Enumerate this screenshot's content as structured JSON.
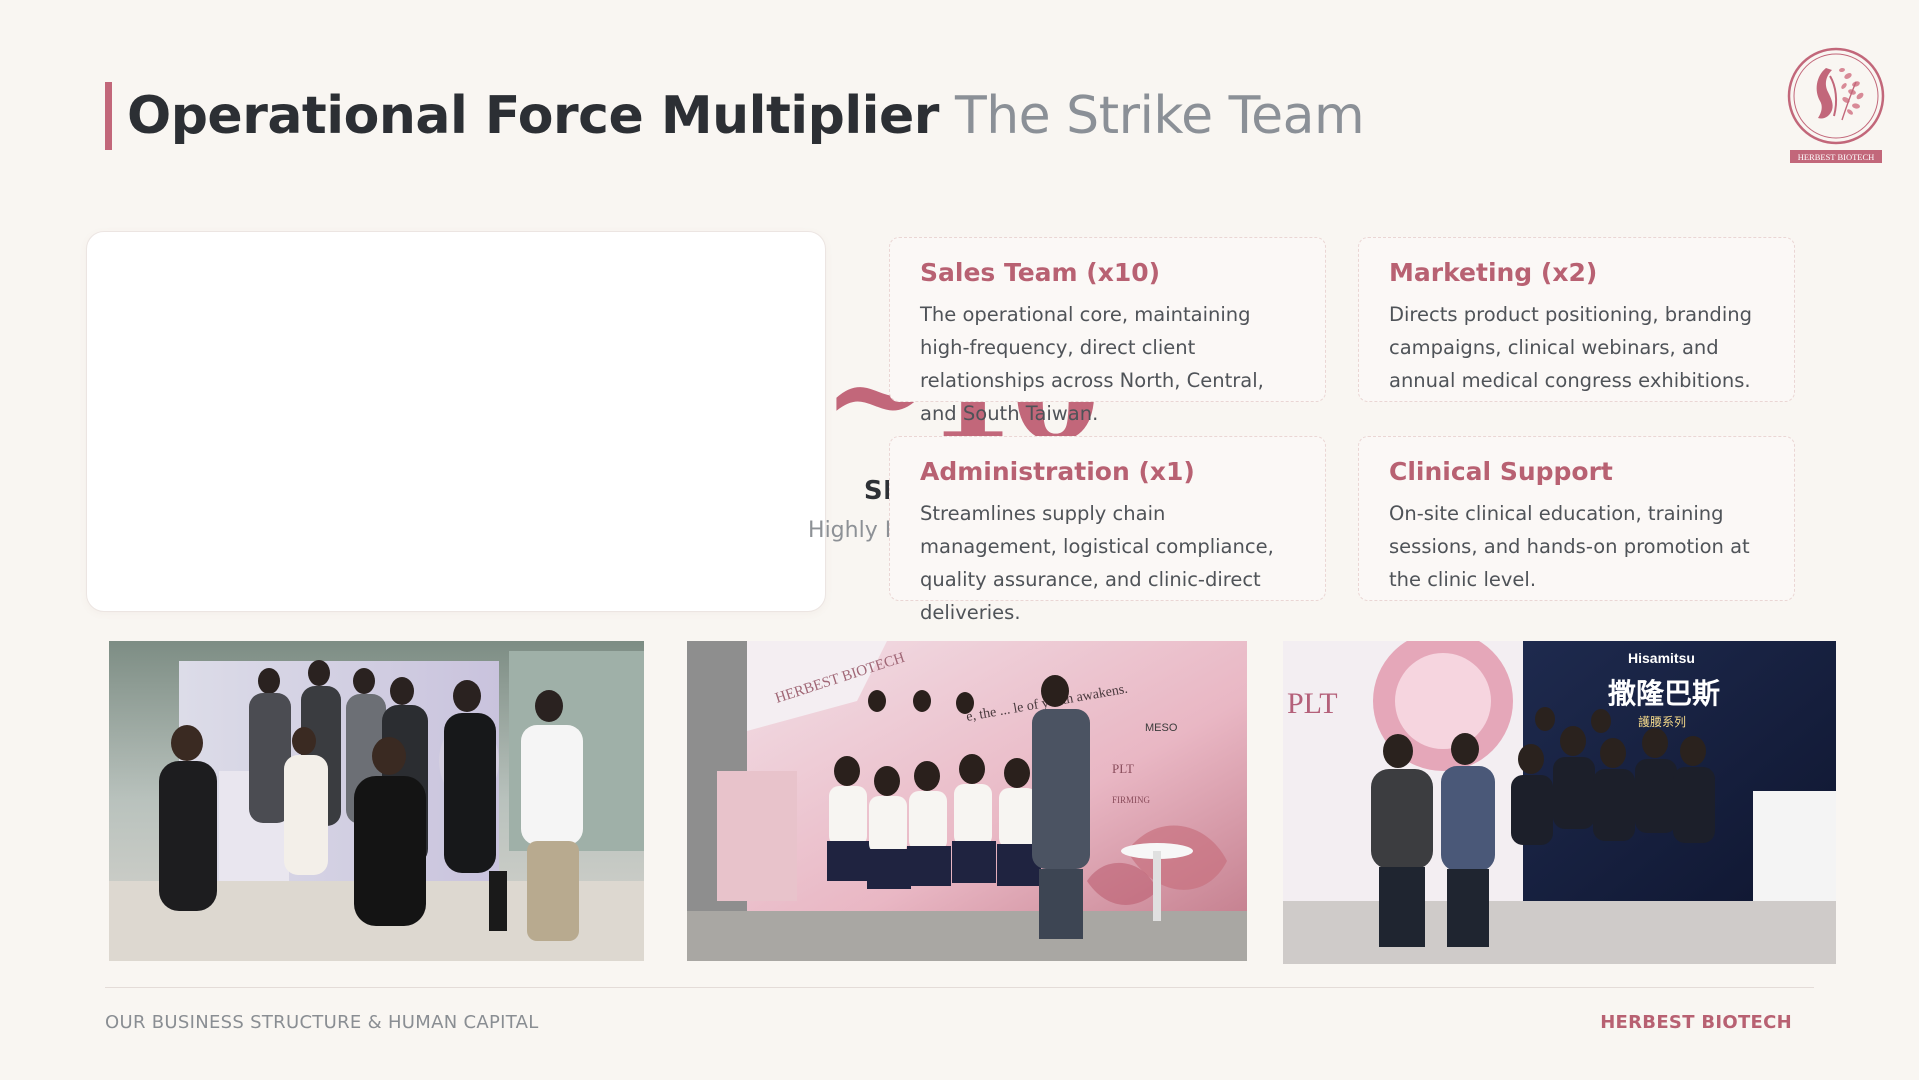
{
  "header": {
    "title_strong": "Operational Force Multiplier",
    "title_light": "The Strike Team"
  },
  "logo": {
    "text": "HERBEST BIOTECH",
    "icon": "face-leaf-logo-icon",
    "color": "#c2677a"
  },
  "stat": {
    "number": "~10",
    "label": "SPECIALISTS",
    "sublabel": "Highly Efficient Strike Force"
  },
  "teams": [
    {
      "title": "Sales Team (x10)",
      "description": "The operational core, maintaining high-frequency, direct client relationships across North, Central, and South Taiwan."
    },
    {
      "title": "Marketing (x2)",
      "description": "Directs product positioning, branding campaigns, clinical webinars, and annual medical congress exhibitions."
    },
    {
      "title": "Administration (x1)",
      "description": "Streamlines supply chain management, logistical compliance, quality assurance, and clinic-direct deliveries."
    },
    {
      "title": "Clinical Support",
      "description": "On-site clinical education, training sessions, and hands-on promotion at the clinic level."
    }
  ],
  "photos": {
    "photo2": {
      "banner_brand": "HERBEST BIOTECH",
      "banner_slogan": "e, the ... le of youth awakens.",
      "product1": "MESO",
      "product2": "PLT",
      "product3": "FIRMING"
    },
    "photo3": {
      "booth_plt": "PLT",
      "sponsor": "Hisamitsu",
      "cjk_title": "撒隆巴斯",
      "cjk_sub": "護腰系列"
    }
  },
  "footer": {
    "left": "OUR BUSINESS STRUCTURE & HUMAN CAPITAL",
    "right": "HERBEST BIOTECH"
  },
  "colors": {
    "accent": "#c2677a",
    "background": "#f9f6f2",
    "card_title": "#b86172"
  }
}
